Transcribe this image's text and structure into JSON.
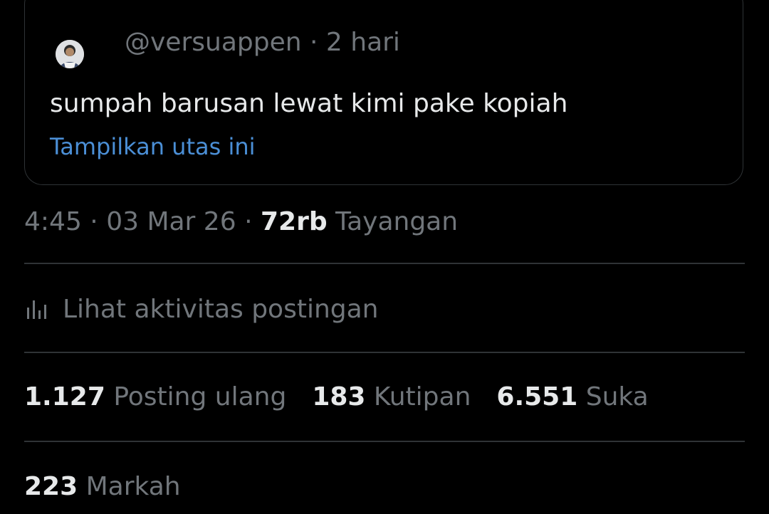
{
  "quote": {
    "handle": "@versuappen",
    "separator": " · ",
    "age": "2 hari",
    "text": "sumpah barusan lewat kimi pake kopiah",
    "show_thread": "Tampilkan utas ini"
  },
  "meta": {
    "time": "4:45",
    "sep1": " · ",
    "date": "03 Mar 26",
    "sep2": " · ",
    "views_count": "72rb",
    "views_label": "Tayangan"
  },
  "activity": {
    "icon": "bar-chart-icon",
    "label": "Lihat aktivitas postingan"
  },
  "stats": [
    {
      "count": "1.127",
      "label": "Posting ulang"
    },
    {
      "count": "183",
      "label": "Kutipan"
    },
    {
      "count": "6.551",
      "label": "Suka"
    }
  ],
  "bookmarks": {
    "count": "223",
    "label": "Markah"
  },
  "colors": {
    "background": "#000000",
    "text_primary": "#e7e9ea",
    "text_secondary": "#71767b",
    "link": "#4b8fd6",
    "border": "#2f3336"
  }
}
